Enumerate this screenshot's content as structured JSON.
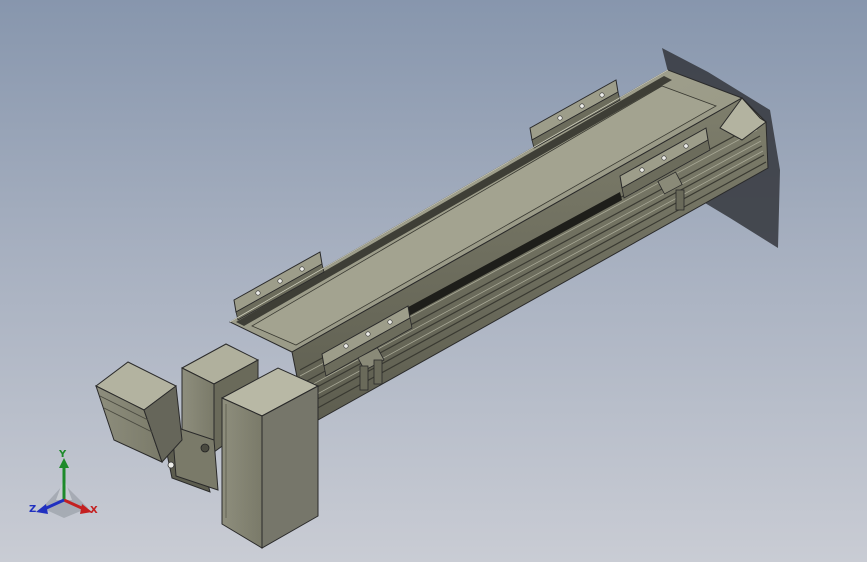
{
  "viewport": {
    "background_top": "#8796ad",
    "background_bottom": "#c9ccd4",
    "model_color": "#9a9a88",
    "edge_color": "#2a2a2a"
  },
  "triad": {
    "x_label": "X",
    "y_label": "Y",
    "z_label": "Z",
    "x_color": "#c42020",
    "y_color": "#1d8a2a",
    "z_color": "#2030c0"
  }
}
